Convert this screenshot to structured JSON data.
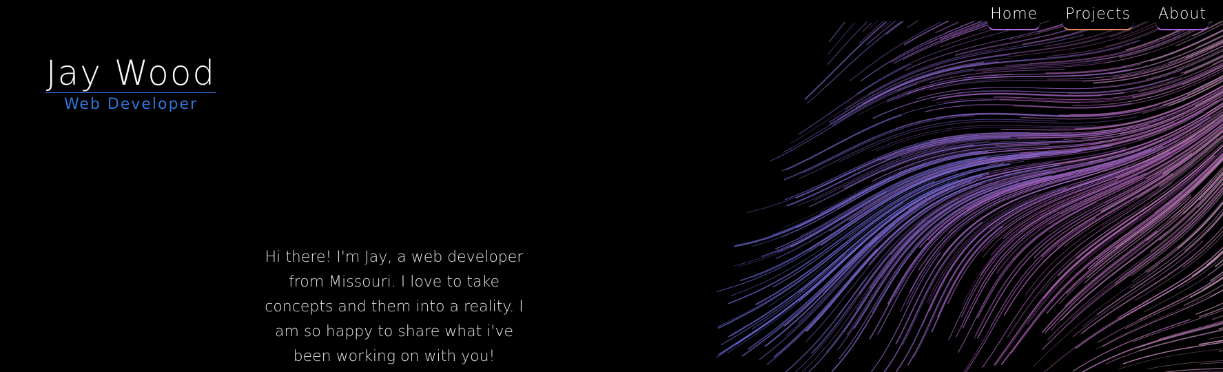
{
  "nav": {
    "items": [
      {
        "label": "Home"
      },
      {
        "label": "Projects"
      },
      {
        "label": "About"
      }
    ]
  },
  "brand": {
    "name": "Jay Wood",
    "role": "Web Developer"
  },
  "intro": {
    "text": "Hi there! I'm Jay, a web developer from Missouri. I love to take concepts and them into a reality. I am so happy to share what i've been working on with you!"
  },
  "colors": {
    "background": "#000000",
    "accent": "#2f74d8",
    "flow_primary": "#6a6ad8",
    "flow_secondary": "#b05fb8",
    "flow_tertiary": "#c9a0b8"
  }
}
